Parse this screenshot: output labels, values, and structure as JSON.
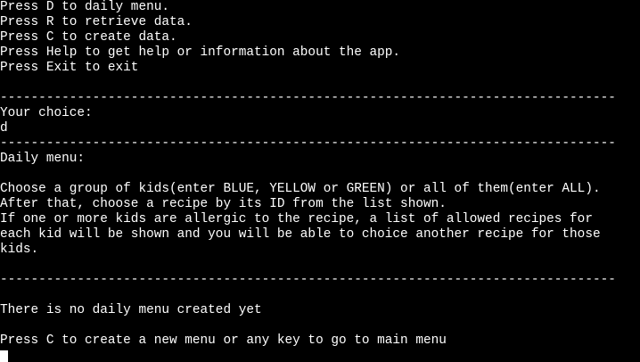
{
  "terminal": {
    "foreground": "#ffffff",
    "background": "#000000",
    "main_menu": {
      "line_daily": "Press D to daily menu.",
      "line_retrieve": "Press R to retrieve data.",
      "line_create": "Press C to create data.",
      "line_help": "Press Help to get help or information about the app.",
      "line_exit": "Press Exit to exit"
    },
    "divider": "--------------------------------------------------------------------------------",
    "choice_prompt": "Your choice:",
    "choice_input": "d",
    "daily_menu": {
      "title": "Daily menu:",
      "instruction_1": "Choose a group of kids(enter BLUE, YELLOW or GREEN) or all of them(enter ALL).",
      "instruction_2": "After that, choose a recipe by its ID from the list shown.",
      "instruction_3": "If one or more kids are allergic to the recipe, a list of allowed recipes for",
      "instruction_4": "each kid will be shown and you will be able to choice another recipe for those",
      "instruction_5": "kids.",
      "status_message": "There is no daily menu created yet",
      "create_prompt": "Press C to create a new menu or any key to go to main menu"
    }
  }
}
